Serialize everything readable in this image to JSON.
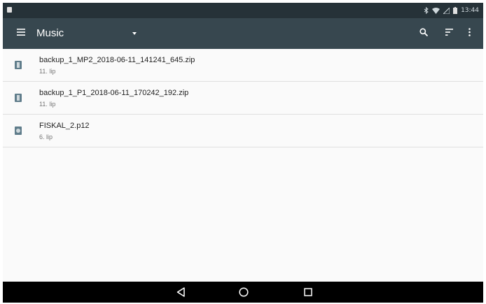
{
  "status_bar": {
    "time": "13:44",
    "icons": [
      "notification-icon",
      "bluetooth-icon",
      "wifi-icon",
      "signal-icon",
      "battery-icon"
    ]
  },
  "toolbar": {
    "title": "Music",
    "icons": [
      "menu-icon",
      "dropdown-icon",
      "search-icon",
      "sort-icon",
      "more-icon"
    ]
  },
  "files": [
    {
      "name": "backup_1_MP2_2018-06-11_141241_645.zip",
      "meta": "11. lip",
      "icon": "zip-file-icon"
    },
    {
      "name": "backup_1_P1_2018-06-11_170242_192.zip",
      "meta": "11. lip",
      "icon": "zip-file-icon"
    },
    {
      "name": "FISKAL_2.p12",
      "meta": "6. lip",
      "icon": "certificate-file-icon"
    }
  ],
  "nav_bar": {
    "icons": [
      "back-icon",
      "home-icon",
      "recents-icon"
    ]
  },
  "colors": {
    "status_bar": "#263238",
    "toolbar": "#37474f",
    "list_bg": "#fafafa",
    "nav_bar": "#000000"
  }
}
